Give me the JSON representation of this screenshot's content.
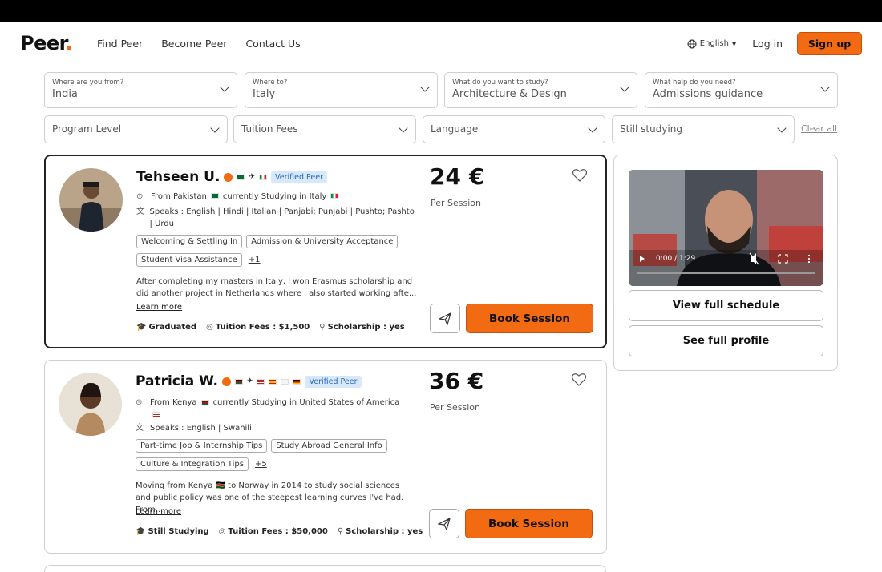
{
  "header": {
    "logo": "Peer",
    "logo_dot": ".",
    "nav": [
      "Find Peer",
      "Become Peer",
      "Contact Us"
    ],
    "language": "English",
    "login": "Log in",
    "signup": "Sign up"
  },
  "filters": {
    "from": {
      "label": "Where are you from?",
      "value": "India"
    },
    "to": {
      "label": "Where to?",
      "value": "Italy"
    },
    "study": {
      "label": "What do you want to study?",
      "value": "Architecture & Design"
    },
    "help": {
      "label": "What help do you need?",
      "value": "Admissions guidance"
    },
    "program_level": "Program Level",
    "tuition_fees": "Tuition Fees",
    "language": "Language",
    "status": "Still studying",
    "clear_all": "Clear all"
  },
  "peers": [
    {
      "name": "Tehseen U.",
      "verified": "Verified Peer",
      "from": "From Pakistan",
      "studying": "currently Studying in Italy",
      "speaks": "Speaks : English | Hindi | Italian | Panjabi; Punjabi | Pushto; Pashto | Urdu",
      "tags": [
        "Welcoming & Settling In",
        "Admission & University Acceptance",
        "Student Visa Assistance"
      ],
      "more": "+1",
      "description": "After completing my masters in Italy, i won Erasmus scholarship and did another project in Netherlands where i also started working afte...",
      "learn_more": "Learn more",
      "status": "Graduated",
      "tuition": "Tuition Fees : $1,500",
      "scholarship": "Scholarship : yes",
      "price": "24 €",
      "per_session": "Per Session",
      "book": "Book Session"
    },
    {
      "name": "Patricia W.",
      "verified": "Verified Peer",
      "from": "From Kenya",
      "studying": "currently Studying in United States of America",
      "speaks": "Speaks : English | Swahili",
      "tags": [
        "Part-time Job & Internship Tips",
        "Study Abroad General Info",
        "Culture & Integration Tips"
      ],
      "more": "+5",
      "description": "Moving from Kenya 🇰🇪 to Norway in 2014 to study social sciences and public policy was one of the steepest learning curves I've had. From...",
      "learn_more": "Learn more",
      "status": "Still Studying",
      "tuition": "Tuition Fees : $50,000",
      "scholarship": "Scholarship : yes",
      "price": "36 €",
      "per_session": "Per Session",
      "book": "Book Session"
    }
  ],
  "sidebar": {
    "video_time": "0:00 / 1:29",
    "view_schedule": "View full schedule",
    "see_profile": "See full profile"
  }
}
